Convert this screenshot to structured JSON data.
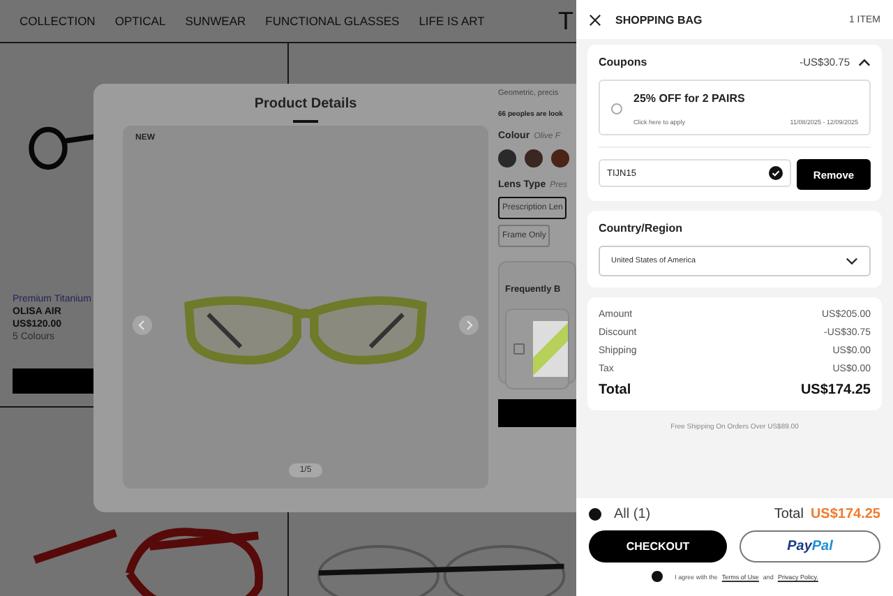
{
  "nav": {
    "items": [
      "COLLECTION",
      "OPTICAL",
      "SUNWEAR",
      "FUNCTIONAL GLASSES",
      "LIFE IS ART"
    ],
    "logo_text": "T"
  },
  "product_card": {
    "material": "Premium Titanium",
    "name": "OLISA AIR",
    "price": "US$120.00",
    "colours": "5 Colours"
  },
  "modal": {
    "title": "Product Details",
    "badge": "NEW",
    "pager": "1/5",
    "description": "Geometric, precis",
    "viewers": "66 peoples are look",
    "colour_label": "Colour",
    "colour_value": "Olive F",
    "swatches": [
      {
        "color": "#2a2a2a",
        "selected": false
      },
      {
        "color": "#3a2722",
        "selected": false
      },
      {
        "color": "#4a2416",
        "selected": false
      }
    ],
    "lens_label": "Lens Type",
    "lens_value": "Pres",
    "lens_options": [
      {
        "label": "Prescription Len",
        "selected": true
      },
      {
        "label": "Frame Only",
        "selected": false
      }
    ],
    "bundle_title": "Frequently B",
    "bundle_checked": false
  },
  "bag": {
    "title": "SHOPPING BAG",
    "count": "1 ITEM",
    "coupons": {
      "label": "Coupons",
      "amount": "-US$30.75",
      "expanded": true,
      "offer": {
        "title": "25% OFF for 2 PAIRS",
        "hint": "Click here to apply",
        "dates": "11/08/2025 - 12/09/2025",
        "selected": false
      },
      "code": "TIJN15",
      "code_valid": true,
      "remove": "Remove"
    },
    "region": {
      "label": "Country/Region",
      "value": "United States of America"
    },
    "summary": [
      {
        "label": "Amount",
        "value": "US$205.00"
      },
      {
        "label": "Discount",
        "value": "-US$30.75"
      },
      {
        "label": "Shipping",
        "value": "US$0.00"
      },
      {
        "label": "Tax",
        "value": "US$0.00"
      }
    ],
    "total_label": "Total",
    "total_value": "US$174.25",
    "free_shipping": "Free Shipping On Orders Over US$89.00"
  },
  "footer": {
    "all_label": "All (1)",
    "all_checked": true,
    "total_label": "Total",
    "total_value": "US$174.25",
    "checkout": "CHECKOUT",
    "paypal_left": "Pay",
    "paypal_right": "Pal",
    "agree_checked": true,
    "agree_text": "I agree with the",
    "terms": "Terms of Use",
    "and": "and",
    "privacy": "Privacy Policy."
  }
}
